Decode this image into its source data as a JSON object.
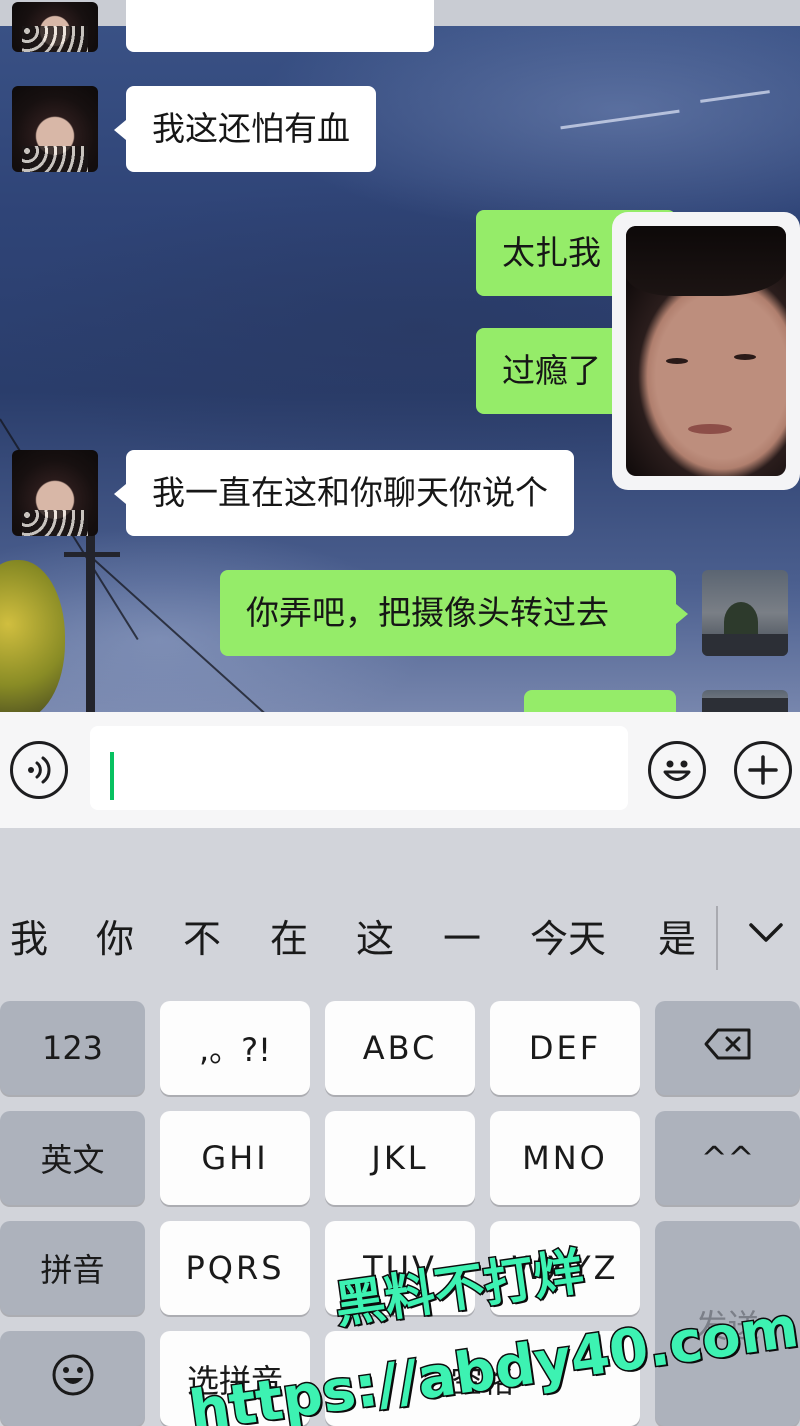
{
  "chat": {
    "messages": [
      {
        "side": "left",
        "text": ""
      },
      {
        "side": "left",
        "text": "我这还怕有血"
      },
      {
        "side": "right",
        "text": "太扎我"
      },
      {
        "side": "right",
        "text": "过瘾了"
      },
      {
        "side": "left",
        "text": "我一直在这和你聊天你说个"
      },
      {
        "side": "right",
        "text": "你弄吧，把摄像头转过去"
      },
      {
        "side": "right",
        "text": ""
      }
    ]
  },
  "input_bar": {
    "voice_icon": "voice-icon",
    "text_value": "",
    "emoji_icon": "emoji-icon",
    "plus_icon": "plus-icon"
  },
  "keyboard": {
    "candidates": [
      "我",
      "你",
      "不",
      "在",
      "这",
      "一",
      "今天",
      "是"
    ],
    "collapse_icon": "chevron-down-icon",
    "keys": {
      "num": "123",
      "punct": ",。?!",
      "abc": "ABC",
      "def": "DEF",
      "delete_icon": "backspace-icon",
      "english": "英文",
      "ghi": "GHI",
      "jkl": "JKL",
      "mno": "MNO",
      "emoticon": "^^",
      "pinyin": "拼音",
      "pqrs": "PQRS",
      "tuv": "TUV",
      "wxyz": "WXYZ",
      "send": "发送",
      "emoji_icon": "emoji-icon",
      "select_pinyin": "选拼音",
      "space": "空格"
    }
  },
  "watermark": {
    "line1": "黑料不打烊",
    "line2": "https://abdy40.com"
  }
}
